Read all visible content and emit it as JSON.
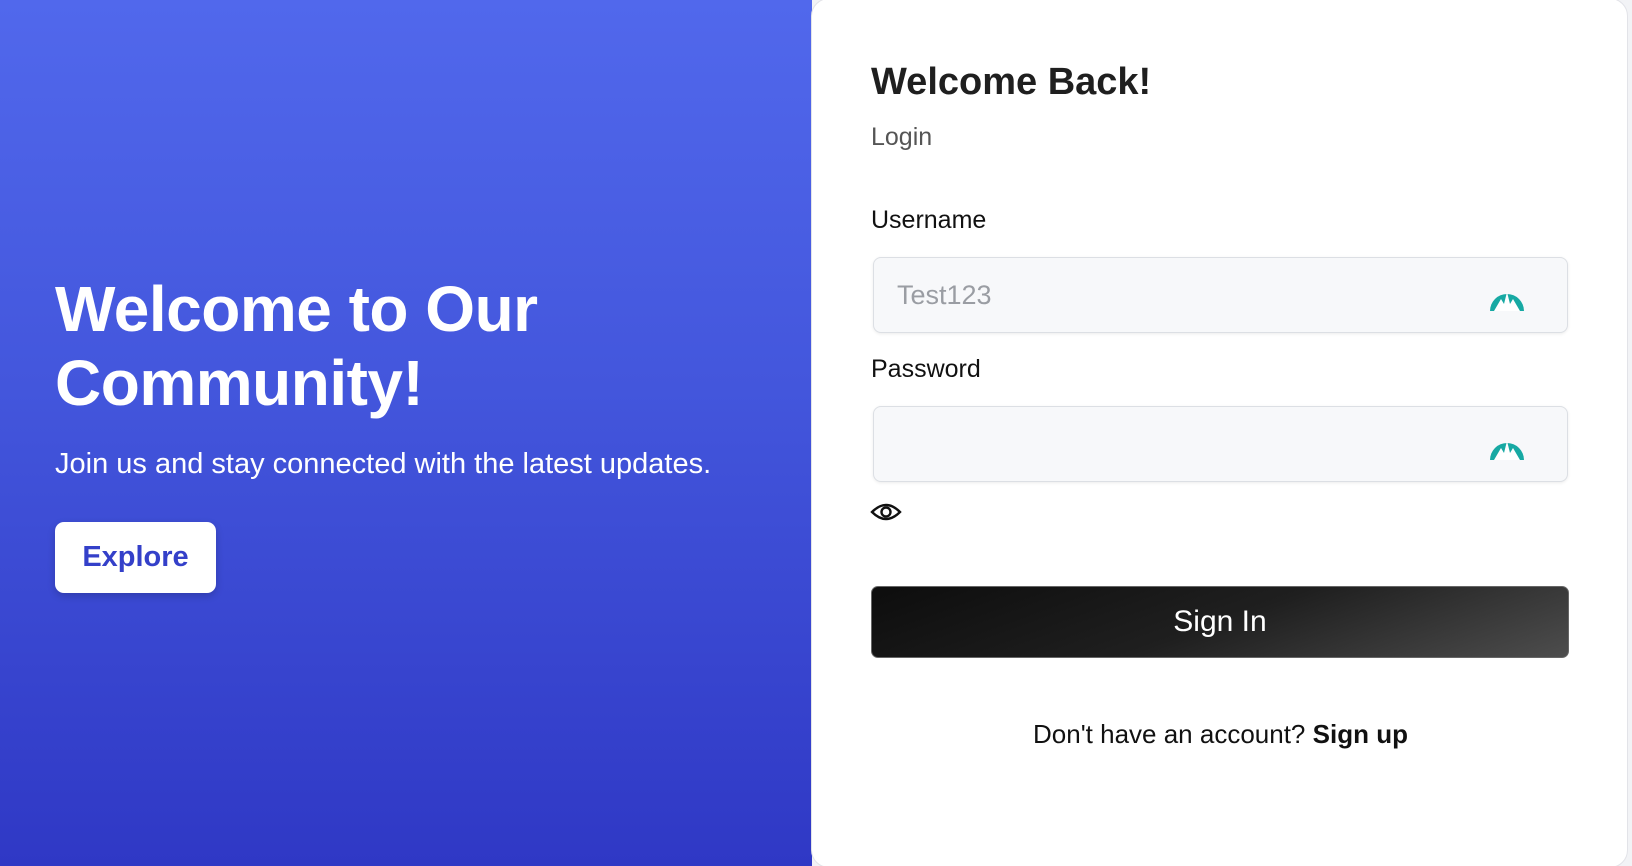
{
  "hero": {
    "title": "Welcome to Our Community!",
    "subtitle": "Join us and stay connected with the latest updates.",
    "explore_label": "Explore"
  },
  "login": {
    "title": "Welcome Back!",
    "subtitle": "Login",
    "username_label": "Username",
    "username_placeholder": "Test123",
    "username_icon": "autofill-mountain-icon",
    "password_label": "Password",
    "password_value": "",
    "password_icon": "autofill-mountain-icon",
    "show_password_icon": "eye-icon",
    "signin_label": "Sign In",
    "signup_prompt": "Don't have an account?",
    "signup_link": "Sign up"
  },
  "colors": {
    "hero_gradient_top": "#5168ec",
    "hero_gradient_bottom": "#2f38c5",
    "explore_text": "#3440c9",
    "autofill_icon": "#17a9a3",
    "signin_bg": "#111111"
  }
}
